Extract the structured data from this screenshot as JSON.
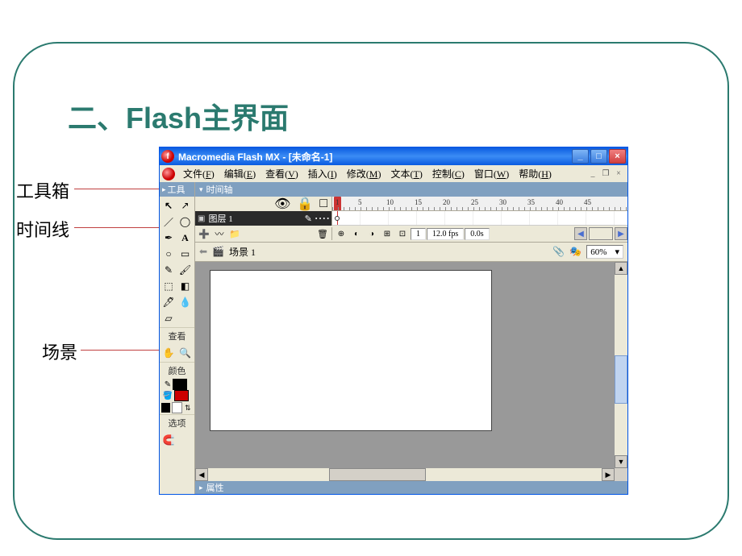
{
  "slide": {
    "title": "二、Flash主界面"
  },
  "labels": {
    "toolbox": "工具箱",
    "timeline": "时间线",
    "scene": "场景"
  },
  "window": {
    "title": "Macromedia Flash MX - [未命名-1]",
    "controls": {
      "minimize": "_",
      "maximize": "□",
      "close": "×"
    }
  },
  "menu": {
    "items": [
      {
        "label": "文件",
        "key": "F"
      },
      {
        "label": "编辑",
        "key": "E"
      },
      {
        "label": "查看",
        "key": "V"
      },
      {
        "label": "插入",
        "key": "I"
      },
      {
        "label": "修改",
        "key": "M"
      },
      {
        "label": "文本",
        "key": "T"
      },
      {
        "label": "控制",
        "key": "C"
      },
      {
        "label": "窗口",
        "key": "W"
      },
      {
        "label": "帮助",
        "key": "H"
      }
    ],
    "doc_controls": {
      "min": "_",
      "restore": "❐",
      "close": "×"
    }
  },
  "tools": {
    "header": "工具",
    "sections": {
      "view": "查看",
      "colors": "颜色",
      "options": "选项"
    },
    "icons": {
      "arrow": "↖",
      "subselect": "↗",
      "line": "／",
      "lasso": "◯",
      "pen": "✒",
      "text": "A",
      "oval": "○",
      "rect": "▭",
      "pencil": "✎",
      "brush": "🖌",
      "transform": "⬚",
      "fill": "◧",
      "ink": "🖋",
      "eyedrop": "💧",
      "eraser": "▱",
      "hand": "✋",
      "zoom": "🔍",
      "magnet": "🧲"
    },
    "colors": {
      "stroke": "#000000",
      "fill": "#cc0000"
    }
  },
  "timeline": {
    "header": "时间轴",
    "layer": {
      "name": "图层 1"
    },
    "ruler": [
      "1",
      "5",
      "10",
      "15",
      "20",
      "25",
      "30",
      "35",
      "40",
      "45"
    ],
    "status": {
      "frame": "1",
      "fps": "12.0 fps",
      "time": "0.0s"
    },
    "controls": {
      "eye": "👁",
      "lock": "🔒",
      "outline": "□",
      "pen": "✎",
      "dots": "• • • •",
      "add_layer": "➕",
      "add_folder": "📁",
      "add_guide": "〰",
      "trash": "🗑"
    }
  },
  "scene": {
    "back": "⬅",
    "icon": "🎬",
    "name": "场景 1",
    "symbol_btn": "📎",
    "scene_btn": "🎭",
    "zoom": "60%"
  },
  "properties": {
    "header": "属性"
  }
}
